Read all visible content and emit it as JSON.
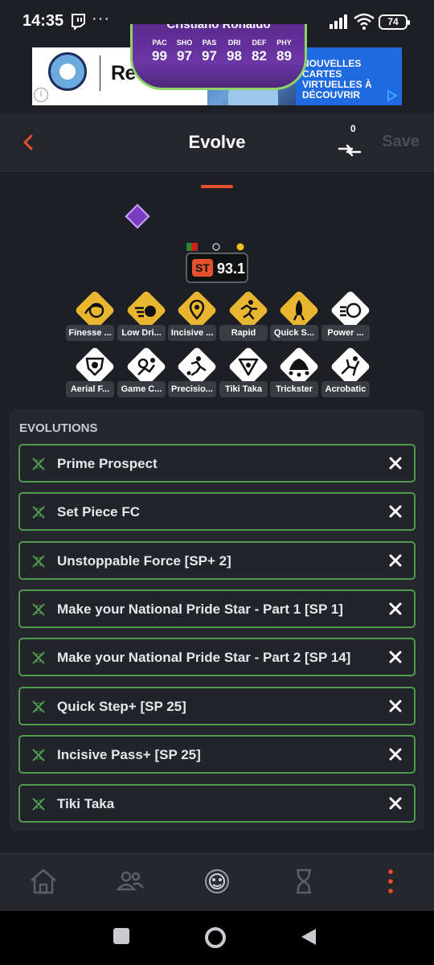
{
  "status": {
    "time": "14:35",
    "dots": "···",
    "battery": "74"
  },
  "ad": {
    "brand": "Revolut",
    "promo": "NOUVELLES CARTES VIRTUELLES À DÉCOUVRIR",
    "info": "i"
  },
  "header": {
    "title": "Evolve",
    "compare_count": "0",
    "save_label": "Save"
  },
  "player": {
    "name": "Cristiano Ronaldo",
    "stats": [
      {
        "label": "PAC",
        "value": "99"
      },
      {
        "label": "SHO",
        "value": "97"
      },
      {
        "label": "PAS",
        "value": "97"
      },
      {
        "label": "DRI",
        "value": "98"
      },
      {
        "label": "DEF",
        "value": "82"
      },
      {
        "label": "PHY",
        "value": "89"
      }
    ],
    "position": "ST",
    "rating": "93.1"
  },
  "playstyles": [
    {
      "label": "Finesse ...",
      "plus": true
    },
    {
      "label": "Low Dri...",
      "plus": true
    },
    {
      "label": "Incisive ...",
      "plus": true
    },
    {
      "label": "Rapid",
      "plus": true
    },
    {
      "label": "Quick S...",
      "plus": true
    },
    {
      "label": "Power ...",
      "plus": false
    },
    {
      "label": "Aerial F...",
      "plus": false
    },
    {
      "label": "Game C...",
      "plus": false
    },
    {
      "label": "Precisio...",
      "plus": false
    },
    {
      "label": "Tiki Taka",
      "plus": false
    },
    {
      "label": "Trickster",
      "plus": false
    },
    {
      "label": "Acrobatic",
      "plus": false
    }
  ],
  "evolutions": {
    "heading": "EVOLUTIONS",
    "items": [
      "Prime Prospect",
      "Set Piece FC",
      "Unstoppable Force [SP+ 2]",
      "Make your National Pride Star - Part 1 [SP 1]",
      "Make your National Pride Star - Part 2 [SP 14]",
      "Quick Step+ [SP 25]",
      "Incisive Pass+ [SP 25]",
      "Tiki Taka"
    ]
  },
  "colors": {
    "accent": "#e5512c",
    "plus_gold": "#e8b631",
    "evo_border": "#4e9b4e"
  }
}
